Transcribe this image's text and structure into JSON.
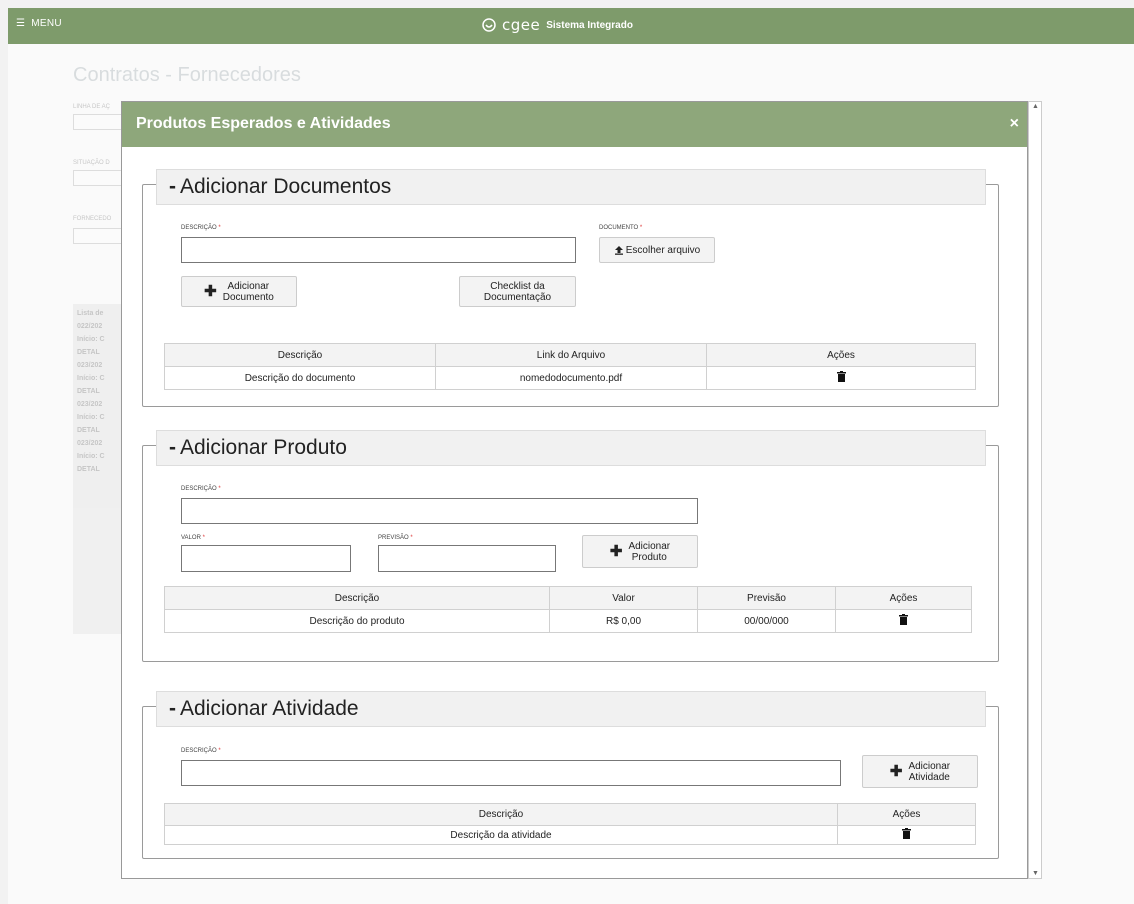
{
  "topbar": {
    "menu_icon": "☰",
    "menu_label": "MENU",
    "brand_logo": "cgee",
    "brand_system": "Sistema Integrado"
  },
  "background": {
    "page_title": "Contratos - Fornecedores",
    "labels": [
      "LINHA DE AÇ",
      "SITUAÇÃO D",
      "FORNECEDO"
    ],
    "list_items": [
      "Lista de",
      "022/202",
      "Início: C",
      "DETAL",
      "023/202",
      "Início: C",
      "DETAL",
      "023/202",
      "Início: C",
      "DETAL",
      "023/202",
      "Início: C",
      "DETAL"
    ]
  },
  "modal": {
    "title": "Produtos Esperados e Atividades",
    "close_icon": "×",
    "documentos": {
      "legend_symbol": "-",
      "legend": "Adicionar Documentos",
      "descricao_label": "DESCRIÇÃO",
      "descricao_value": "",
      "documento_label": "DOCUMENTO",
      "upload_icon": "upload-icon",
      "escolher_label": "Escolher arquivo",
      "add_label_line1": "Adicionar",
      "add_label_line2": "Documento",
      "checklist_line1": "Checklist da",
      "checklist_line2": "Documentação",
      "table": {
        "headers": [
          "Descrição",
          "Link do Arquivo",
          "Ações"
        ],
        "rows": [
          [
            "Descrição do documento",
            "nomedodocumento.pdf"
          ]
        ]
      }
    },
    "produto": {
      "legend_symbol": "-",
      "legend": "Adicionar Produto",
      "descricao_label": "DESCRIÇÃO",
      "valor_label": "VALOR",
      "previsao_label": "PREVISÃO",
      "add_line1": "Adicionar",
      "add_line2": "Produto",
      "table": {
        "headers": [
          "Descrição",
          "Valor",
          "Previsão",
          "Ações"
        ],
        "rows": [
          [
            "Descrição do produto",
            "R$ 0,00",
            "00/00/000"
          ]
        ]
      }
    },
    "atividade": {
      "legend_symbol": "-",
      "legend": "Adicionar Atividade",
      "descricao_label": "DESCRIÇÃO",
      "add_line1": "Adicionar",
      "add_line2": "Atividade",
      "table": {
        "headers": [
          "Descrição",
          "Ações"
        ],
        "rows": [
          [
            "Descrição da atividade"
          ]
        ]
      }
    },
    "required_mark": "*",
    "trash_icon": "trash-icon",
    "plus_icon": "✚"
  },
  "colors": {
    "topbar": "#7e9b6b",
    "modal_header": "#8ea77b"
  }
}
